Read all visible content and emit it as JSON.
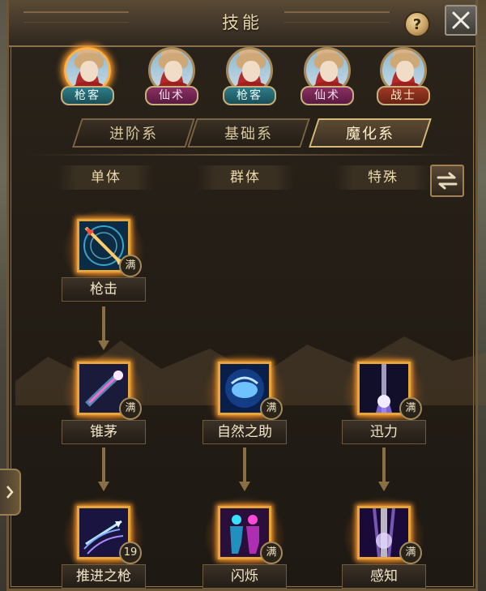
{
  "window": {
    "title": "技能",
    "help_label": "?",
    "close_icon": "close-icon"
  },
  "heroes": [
    {
      "class": "枪客",
      "type": "gun",
      "active": true
    },
    {
      "class": "仙术",
      "type": "mage",
      "active": false
    },
    {
      "class": "枪客",
      "type": "gun",
      "active": false
    },
    {
      "class": "仙术",
      "type": "mage",
      "active": false
    },
    {
      "class": "战士",
      "type": "warrior",
      "active": false
    }
  ],
  "tabs": [
    {
      "label": "进阶系",
      "active": false
    },
    {
      "label": "基础系",
      "active": false
    },
    {
      "label": "魔化系",
      "active": true
    }
  ],
  "columns": [
    "单体",
    "群体",
    "特殊"
  ],
  "skills": [
    {
      "name": "枪击",
      "badge": "满",
      "icon": "spear-strike-icon"
    },
    {
      "name": "锥茅",
      "badge": "满",
      "icon": "comet-spear-icon"
    },
    {
      "name": "自然之助",
      "badge": "满",
      "icon": "nature-aid-icon"
    },
    {
      "name": "迅力",
      "badge": "满",
      "icon": "swift-power-icon"
    },
    {
      "name": "推进之枪",
      "badge": "19",
      "icon": "thrust-spear-icon"
    },
    {
      "name": "闪烁",
      "badge": "满",
      "icon": "blink-icon"
    },
    {
      "name": "感知",
      "badge": "满",
      "icon": "perception-icon"
    }
  ],
  "colors": {
    "accent": "#e8a63a",
    "frame": "#6b5637",
    "text": "#f3e6c7"
  }
}
